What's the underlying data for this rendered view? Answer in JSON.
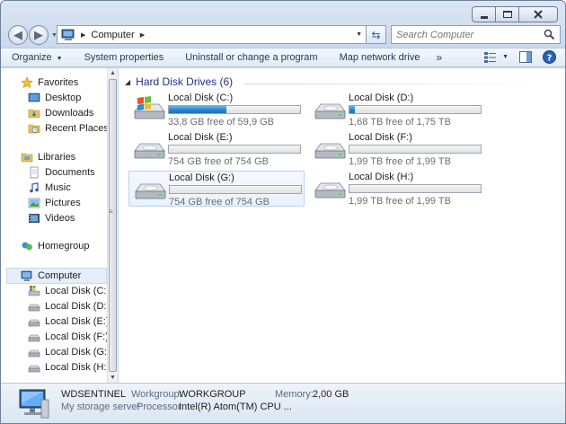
{
  "window": {
    "caption_buttons": [
      "minimize",
      "maximize",
      "close"
    ]
  },
  "address_bar": {
    "breadcrumb": "Computer"
  },
  "search": {
    "placeholder": "Search Computer"
  },
  "command_bar": {
    "items": [
      "Organize",
      "System properties",
      "Uninstall or change a program",
      "Map network drive"
    ],
    "more": "»"
  },
  "nav_pane": {
    "favorites": {
      "label": "Favorites",
      "items": [
        "Desktop",
        "Downloads",
        "Recent Places"
      ]
    },
    "libraries": {
      "label": "Libraries",
      "items": [
        "Documents",
        "Music",
        "Pictures",
        "Videos"
      ]
    },
    "homegroup": {
      "label": "Homegroup"
    },
    "computer": {
      "label": "Computer",
      "items": [
        "Local Disk (C:)",
        "Local Disk (D:)",
        "Local Disk (E:)",
        "Local Disk (F:)",
        "Local Disk (G:)",
        "Local Disk (H:)"
      ]
    }
  },
  "content": {
    "group_title": "Hard Disk Drives (6)",
    "disks": [
      {
        "name": "Local Disk (C:)",
        "free_text": "33,8 GB free of 59,9 GB",
        "used_fraction": 0.44,
        "system": true,
        "selected": false
      },
      {
        "name": "Local Disk (D:)",
        "free_text": "1,68 TB free of 1,75 TB",
        "used_fraction": 0.04,
        "system": false,
        "selected": false
      },
      {
        "name": "Local Disk (E:)",
        "free_text": "754 GB free of 754 GB",
        "used_fraction": 0.0,
        "system": false,
        "selected": false
      },
      {
        "name": "Local Disk (F:)",
        "free_text": "1,99 TB free of 1,99 TB",
        "used_fraction": 0.0,
        "system": false,
        "selected": false
      },
      {
        "name": "Local Disk (G:)",
        "free_text": "754 GB free of 754 GB",
        "used_fraction": 0.0,
        "system": false,
        "selected": true
      },
      {
        "name": "Local Disk (H:)",
        "free_text": "1,99 TB free of 1,99 TB",
        "used_fraction": 0.0,
        "system": false,
        "selected": false
      }
    ],
    "usage_color": "#2784d3"
  },
  "details": {
    "computer_name": "WDSENTINEL",
    "description": "My storage server",
    "workgroup_label": "Workgroup:",
    "workgroup_value": "WORKGROUP",
    "memory_label": "Memory:",
    "memory_value": "2,00 GB",
    "processor_label": "Processor:",
    "processor_value": "Intel(R) Atom(TM) CPU ..."
  }
}
